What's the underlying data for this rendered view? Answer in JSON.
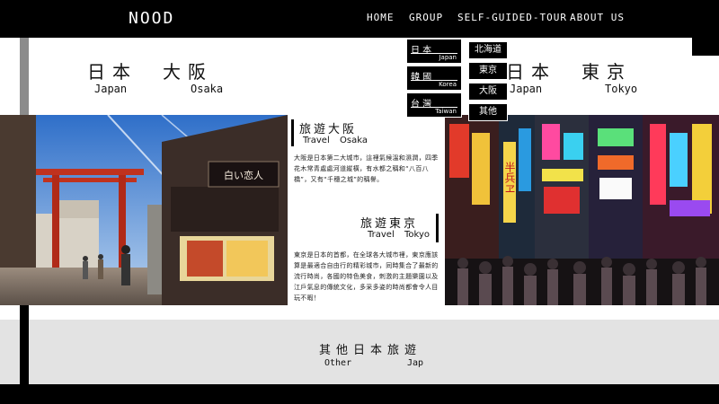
{
  "header": {
    "brand": "NOOD",
    "nav": [
      "HOME",
      "GROUP",
      "SELF-GUIDED-TOUR",
      "ABOUT US"
    ]
  },
  "hero": {
    "left": {
      "cn": "日本　大阪",
      "en_left": "Japan",
      "en_right": "Osaka"
    },
    "right": {
      "cn": "日本　東京",
      "en_left": "Japan",
      "en_right": "Tokyo"
    }
  },
  "dropdown": {
    "countries": [
      {
        "cn": "日 本",
        "en": "Japan"
      },
      {
        "cn": "韓 國",
        "en": "Korea"
      },
      {
        "cn": "台 灣",
        "en": "Taiwan"
      }
    ],
    "cities": [
      "北海道",
      "東京",
      "大阪",
      "其他"
    ]
  },
  "sections": {
    "osaka": {
      "title_cn": "旅遊大阪",
      "title_en_left": "Travel",
      "title_en_right": "Osaka",
      "text": "大阪是日本第二大城市，這裡氣候溫和濕潤，四季花木常青處處河道縱橫，有水都之稱和“八百八橋”，又有“千穗之城”的稱譽。"
    },
    "tokyo": {
      "title_cn": "旅遊東京",
      "title_en_left": "Travel",
      "title_en_right": "Tokyo",
      "text": "東京是日本的首都，在全球各大城市裡，東京應該算是最適合自由行的精彩城市，同時集合了最新的流行時尚，各國的特色美食，刺激的主題樂園以及江戶氣息的傳統文化，多采多姿的時尚都會令人目玩不暇！"
    }
  },
  "other": {
    "cn": "其他日本旅遊",
    "en_left": "Other",
    "en_right": "Jap"
  },
  "photos": {
    "osaka": {
      "sign": "白い恋人"
    },
    "tokyo": {
      "sign": "半兵ヱ"
    }
  }
}
